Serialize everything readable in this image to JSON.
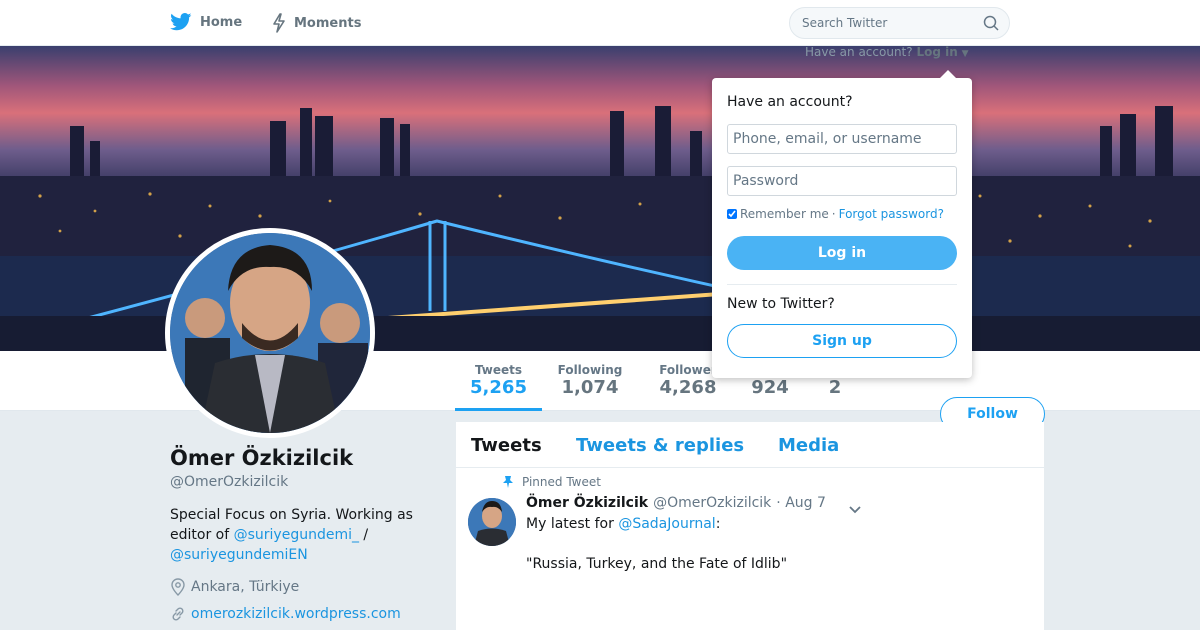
{
  "nav": {
    "home_label": "Home",
    "moments_label": "Moments",
    "search_placeholder": "Search Twitter"
  },
  "login_hint": {
    "prefix": "Have an account?",
    "link": "Log in"
  },
  "login_panel": {
    "title": "Have an account?",
    "username_placeholder": "Phone, email, or username",
    "password_placeholder": "Password",
    "remember_label": "Remember me",
    "separator": "·",
    "forgot_label": "Forgot password?",
    "login_button": "Log in",
    "new_label": "New to Twitter?",
    "signup_button": "Sign up"
  },
  "stats": [
    {
      "label": "Tweets",
      "value": "5,265"
    },
    {
      "label": "Following",
      "value": "1,074"
    },
    {
      "label": "Follower",
      "value": "4,268"
    },
    {
      "label": "",
      "value": "924"
    },
    {
      "label": "",
      "value": "2"
    }
  ],
  "follow_button": "Follow",
  "profile": {
    "name": "Ömer Özkizilcik",
    "handle": "@OmerOzkizilcik",
    "bio_text": "Special Focus on Syria. Working as editor of",
    "bio_link1": "@suriyegundemi_",
    "bio_sep": " / ",
    "bio_link2": "@suriyegundemiEN",
    "location": "Ankara, Türkiye",
    "url": "omerozkizilcik.wordpress.com"
  },
  "timeline": {
    "tabs": [
      "Tweets",
      "Tweets & replies",
      "Media"
    ],
    "pinned_label": "Pinned Tweet",
    "tweet": {
      "name": "Ömer Özkizilcik",
      "handle": "@OmerOzkizilcik",
      "time": "· Aug 7",
      "text_prefix": "My latest for ",
      "mention": "@SadaJournal",
      "text_suffix": ":",
      "quote": "\"Russia, Turkey, and the Fate of Idlib\""
    }
  },
  "colors": {
    "brand": "#1da1f2",
    "link": "#1b95e0",
    "background": "#e6ecf0"
  }
}
